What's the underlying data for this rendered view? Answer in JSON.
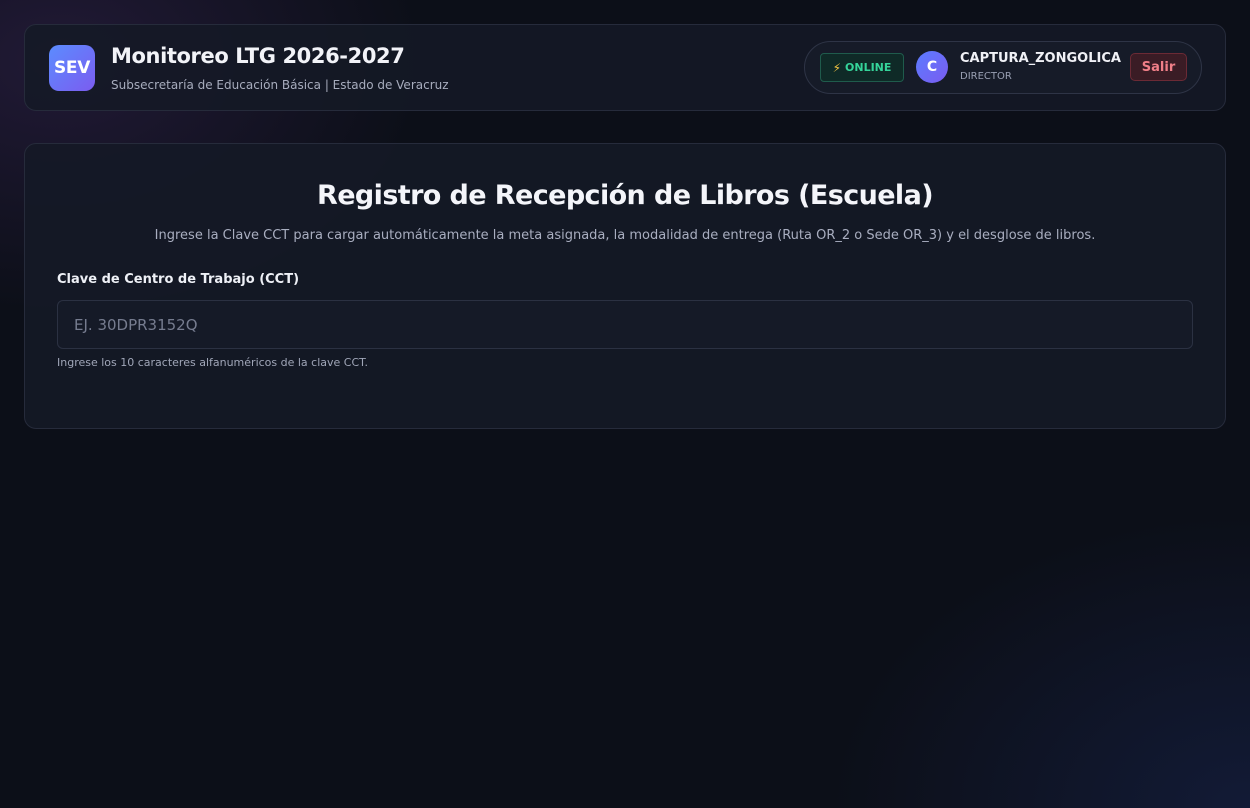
{
  "header": {
    "logo_text": "SEV",
    "title": "Monitoreo LTG 2026-2027",
    "subtitle": "Subsecretaría de Educación Básica | Estado de Veracruz"
  },
  "user_panel": {
    "status_icon": "lightning-icon",
    "status_glyph": "⚡",
    "status_label": "ONLINE",
    "avatar_initial": "C",
    "user_name": "CAPTURA_ZONGOLICA",
    "user_role": "DIRECTOR",
    "logout_label": "Salir"
  },
  "form": {
    "title": "Registro de Recepción de Libros (Escuela)",
    "description": "Ingrese la Clave CCT para cargar automáticamente la meta asignada, la modalidad de entrega (Ruta OR_2 o Sede OR_3) y el desglose de libros.",
    "field_label": "Clave de Centro de Trabajo (CCT)",
    "input_value": "",
    "input_placeholder": "EJ. 30DPR3152Q",
    "field_hint": "Ingrese los 10 caracteres alfanuméricos de la clave CCT."
  },
  "colors": {
    "background": "#0c0f18",
    "accent": "#6a6cf5",
    "online": "#35d49a",
    "danger": "#f07f88"
  }
}
